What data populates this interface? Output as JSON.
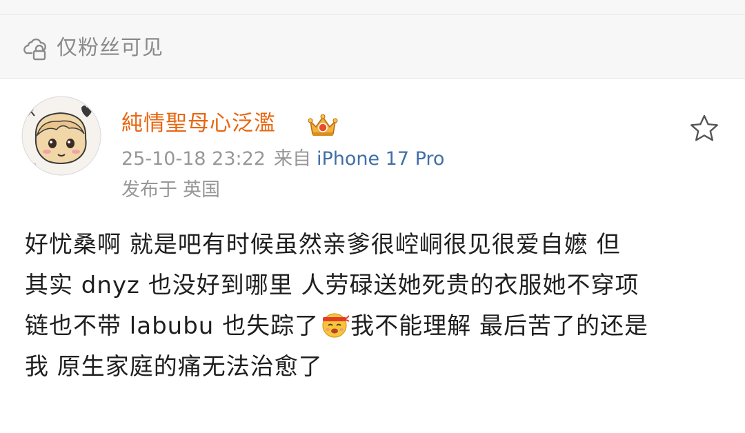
{
  "visibility": {
    "icon": "lock-cloud-icon",
    "label": "仅粉丝可见"
  },
  "post": {
    "username": "純情聖母心泛濫",
    "badge_icon": "crown-badge-icon",
    "username_color": "#e8660f",
    "timestamp": "25-10-18 23:22",
    "source_prefix": "来自",
    "device": "iPhone 17 Pro",
    "device_color": "#3f6fa8",
    "location_prefix": "发布于",
    "location": "英国",
    "favorite_icon": "star-icon",
    "body": {
      "line1": "好忧桑啊 就是吧有时候虽然亲爹很崆峒很见很爱自嬷 但",
      "line2": "其实 dnyz 也没好到哪里 人劳碌送她死贵的衣服她不穿项",
      "line3_a": "链也不带 labubu 也失踪了",
      "line3_emoji": "fighting-face-emoji",
      "line3_b": "我不能理解 最后苦了的还是",
      "line4": "我 原生家庭的痛无法治愈了"
    }
  }
}
